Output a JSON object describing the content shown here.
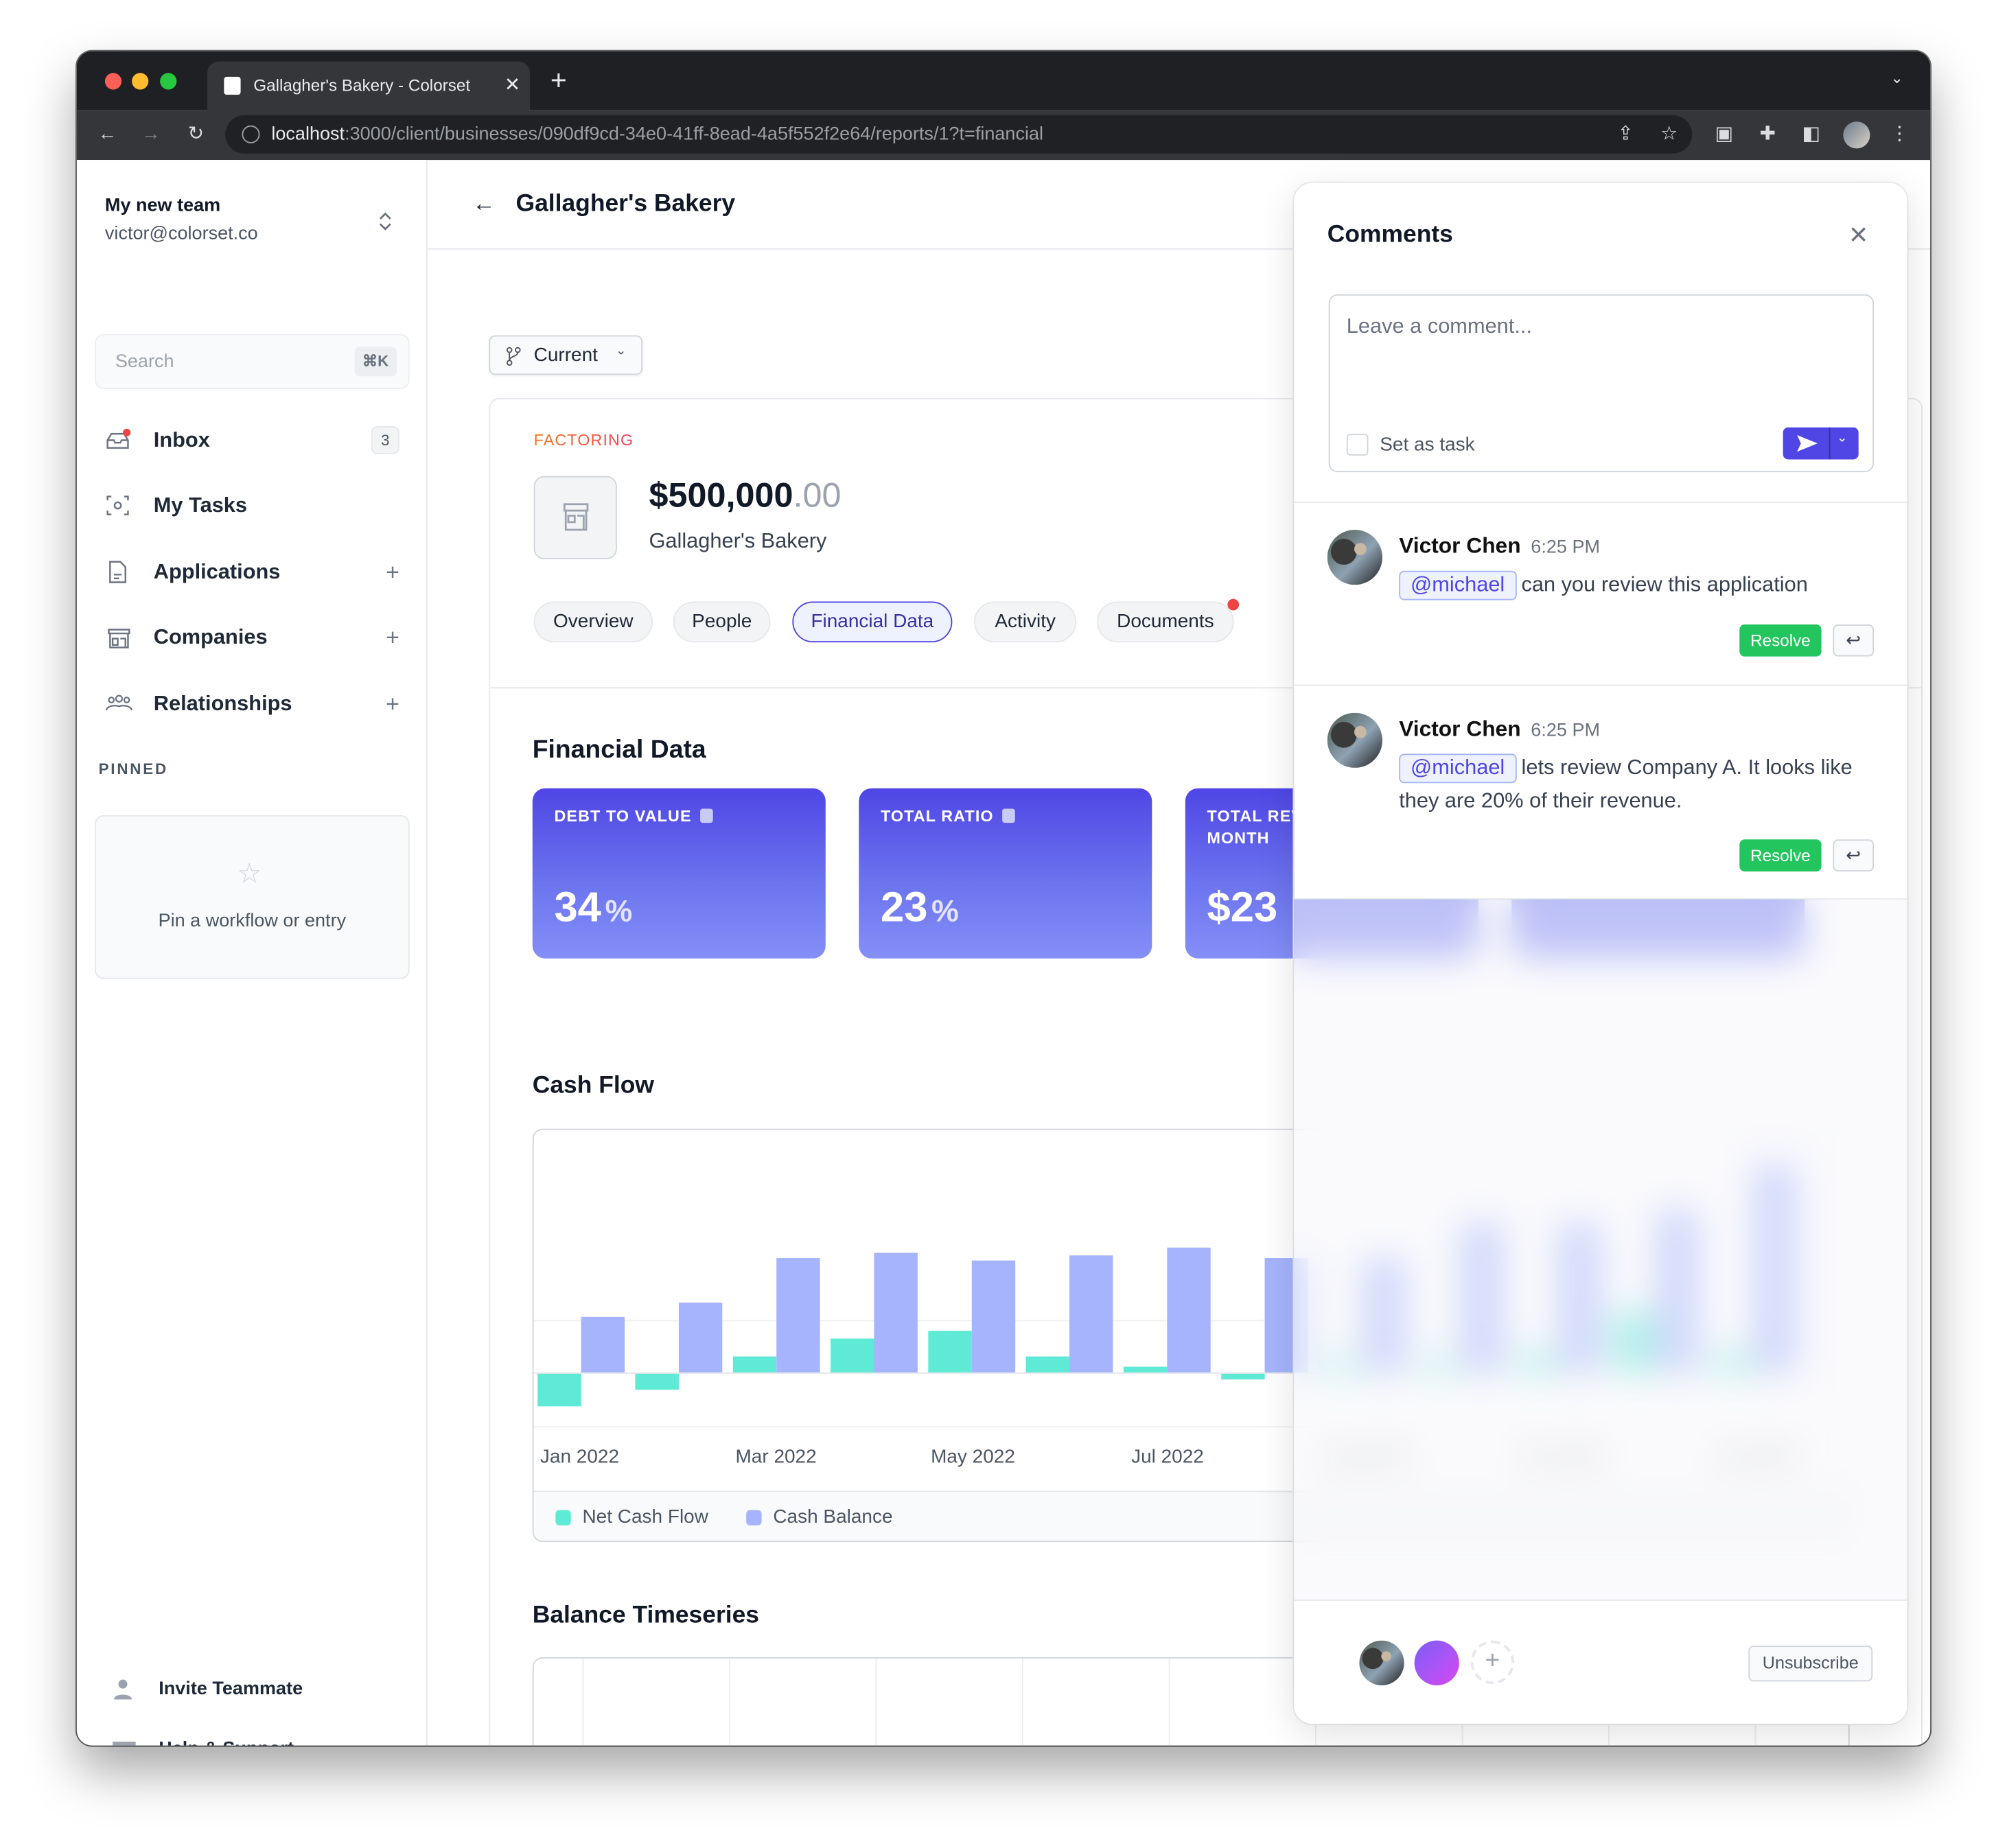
{
  "browser": {
    "tab_title": "Gallagher's Bakery - Colorset",
    "url_host": "localhost",
    "url_rest": ":3000/client/businesses/090df9cd-34e0-41ff-8ead-4a5f552f2e64/reports/1?t=financial"
  },
  "sidebar": {
    "team_name": "My new team",
    "email": "victor@colorset.co",
    "search_placeholder": "Search",
    "search_shortcut": "⌘K",
    "items": [
      {
        "label": "Inbox",
        "badge": "3"
      },
      {
        "label": "My Tasks"
      },
      {
        "label": "Applications"
      },
      {
        "label": "Companies"
      },
      {
        "label": "Relationships"
      }
    ],
    "pinned_heading": "PINNED",
    "pinned_empty": "Pin a workflow or entry",
    "invite": "Invite Teammate",
    "help": "Help & Support"
  },
  "header": {
    "title": "Gallagher's Bakery"
  },
  "version_select": "Current",
  "deal": {
    "type_label": "FACTORING",
    "amount_main": "$500,000",
    "amount_cents": ".00",
    "company": "Gallagher's Bakery",
    "tabs": [
      "Overview",
      "People",
      "Financial Data",
      "Activity",
      "Documents"
    ],
    "active_tab": "Financial Data"
  },
  "financial": {
    "heading": "Financial Data",
    "kpis": [
      {
        "label": "DEBT TO VALUE",
        "value": "34",
        "unit": "%"
      },
      {
        "label": "TOTAL RATIO",
        "value": "23",
        "unit": "%"
      },
      {
        "label": "TOTAL REVENUE PER MONTH",
        "value": "$23",
        "unit": ""
      }
    ],
    "cash_flow_heading": "Cash Flow",
    "balance_heading": "Balance Timeseries"
  },
  "chart_data": {
    "type": "bar",
    "categories": [
      "Jan 2022",
      "Feb 2022",
      "Mar 2022",
      "Apr 2022",
      "May 2022",
      "Jun 2022",
      "Jul 2022",
      "Aug 2022",
      "Sep 2022",
      "Oct 2022",
      "Nov 2022",
      "Dec 2022",
      "Jan 2023"
    ],
    "tick_labels": [
      "Jan 2022",
      "Mar 2022",
      "May 2022",
      "Jul 2022",
      "Sep 2022",
      "Nov 2022",
      "Jan 2023"
    ],
    "series": [
      {
        "name": "Net Cash Flow",
        "color": "#5eead4",
        "values": [
          -26,
          -13,
          13,
          27,
          33,
          13,
          5,
          -5,
          10,
          10,
          15,
          48,
          15
        ]
      },
      {
        "name": "Cash Balance",
        "color": "#a5b4fc",
        "values": [
          44,
          55,
          90,
          94,
          88,
          92,
          98,
          90,
          90,
          118,
          118,
          128,
          163
        ]
      }
    ],
    "ylim": [
      -42,
      173
    ],
    "grid": true,
    "legend": "bottom-left"
  },
  "comments": {
    "title": "Comments",
    "placeholder": "Leave a comment...",
    "set_as_task": "Set as task",
    "items": [
      {
        "author": "Victor Chen",
        "time": "6:25 PM",
        "mention": "@michael",
        "text": "can you review this application",
        "resolve": "Resolve"
      },
      {
        "author": "Victor Chen",
        "time": "6:25 PM",
        "mention": "@michael",
        "text": "lets review Company A. It looks like they are 20% of their revenue.",
        "resolve": "Resolve"
      }
    ],
    "unsubscribe": "Unsubscribe"
  },
  "colors": {
    "accent": "#4f46e5",
    "success": "#22c55e",
    "factoring": "#f97316"
  }
}
